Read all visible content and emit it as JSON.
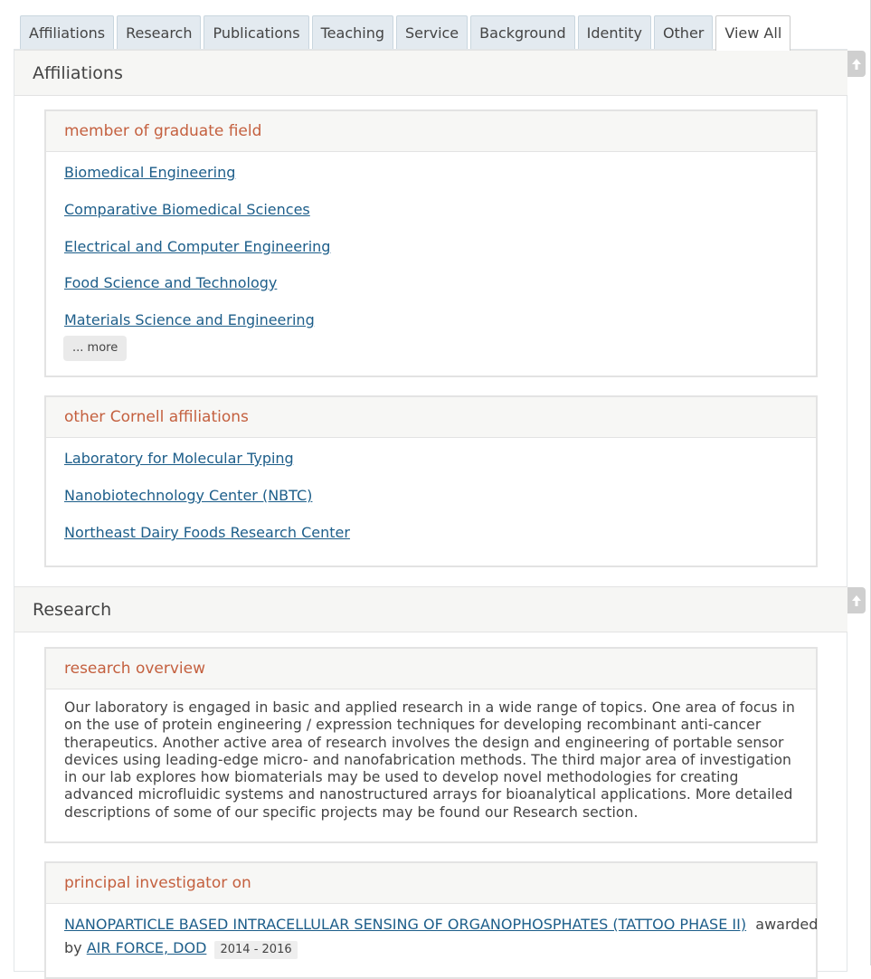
{
  "tabs": [
    {
      "label": "Affiliations",
      "active": false
    },
    {
      "label": "Research",
      "active": false
    },
    {
      "label": "Publications",
      "active": false
    },
    {
      "label": "Teaching",
      "active": false
    },
    {
      "label": "Service",
      "active": false
    },
    {
      "label": "Background",
      "active": false
    },
    {
      "label": "Identity",
      "active": false
    },
    {
      "label": "Other",
      "active": false
    },
    {
      "label": "View All",
      "active": true
    }
  ],
  "affiliations": {
    "title": "Affiliations",
    "graduate_field": {
      "title": "member of graduate field",
      "items": [
        "Biomedical Engineering",
        "Comparative Biomedical Sciences",
        "Electrical and Computer Engineering",
        "Food Science and Technology",
        "Materials Science and Engineering"
      ],
      "more_label": "... more"
    },
    "other": {
      "title": "other Cornell affiliations",
      "items": [
        "Laboratory for Molecular Typing",
        "Nanobiotechnology Center (NBTC)",
        "Northeast Dairy Foods Research Center"
      ]
    }
  },
  "research": {
    "title": "Research",
    "overview": {
      "title": "research overview",
      "text": "Our laboratory is engaged in basic and applied research in a wide range of topics. One area of focus in on the use of protein engineering / expression techniques for developing recombinant anti-cancer therapeutics. Another active area of research involves the design and engineering of portable sensor devices using leading-edge micro- and nanofabrication methods. The third major area of investigation in our lab explores how biomaterials may be used to develop novel methodologies for creating advanced microfluidic systems and nanostructured arrays for bioanalytical applications. More detailed descriptions of some of our specific projects may be found our Research section."
    },
    "pi": {
      "title": "principal investigator on",
      "grant_title": "NANOPARTICLE BASED INTRACELLULAR SENSING OF ORGANOPHOSPHATES (TATTOO PHASE II)",
      "awarded_text": "awarded",
      "by_text": "by",
      "sponsor": "AIR FORCE, DOD",
      "dates": "2014 - 2016"
    }
  }
}
